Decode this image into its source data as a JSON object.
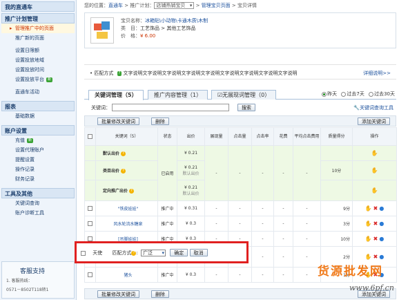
{
  "sidebar": {
    "header": "我的直通车",
    "sections": [
      {
        "title": "推广计划管理",
        "items": [
          {
            "label": "管理推广中的页面",
            "active": true
          },
          {
            "label": "推广新的页面"
          }
        ]
      },
      {
        "title": null,
        "items": [
          {
            "label": "设置日限额"
          },
          {
            "label": "设置投放地域"
          },
          {
            "label": "设置投放时间"
          },
          {
            "label": "设置投放平台",
            "badge": "新"
          }
        ]
      },
      {
        "title": null,
        "items": [
          {
            "label": "直通车活动"
          }
        ]
      },
      {
        "title": "报表",
        "items": [
          {
            "label": "基础数据"
          }
        ]
      },
      {
        "title": "账户设置",
        "items": [
          {
            "label": "充值",
            "badge": "新"
          },
          {
            "label": "设置代理账户"
          },
          {
            "label": "提醒设置"
          },
          {
            "label": "操作记录"
          },
          {
            "label": "财务记录"
          }
        ]
      },
      {
        "title": "工具及其他",
        "items": [
          {
            "label": "关键词查询"
          },
          {
            "label": "账户诊断工具"
          }
        ]
      }
    ],
    "support": {
      "title": "客服支持",
      "line1": "1. 客服热线：",
      "line2": "0571－8502T118转1"
    }
  },
  "breadcrumb": {
    "prefix": "您的位置：",
    "home": "直通车",
    "sep1": ">",
    "plan_label": "推广计划：",
    "plan_value": "店铺热销宝贝",
    "sep2": ">",
    "page": "管理宝贝页面",
    "sep3": ">",
    "current": "宝贝详情"
  },
  "product": {
    "name_label": "宝贝名称：",
    "name": "冰箱贴\\小动物\\卡通木质\\木制",
    "cat_label": "类　目：",
    "cat": "工艺饰品 > 其他工艺饰品",
    "price_label": "价　格：",
    "price": "¥ 6.00"
  },
  "description": {
    "label": "匹配方式",
    "text": "文字说明文字说明文字说明文字说明文字说明文字说明文字说明文字说明文字说明",
    "more": "详细说明>>"
  },
  "tabs": [
    {
      "label": "关键词管理（5）",
      "active": true
    },
    {
      "label": "推广内容管理（1）"
    },
    {
      "label": "无展现词管理（0）"
    }
  ],
  "period": {
    "opt1": "昨天",
    "opt2": "过去7天",
    "opt3": "过去30天"
  },
  "search": {
    "label": "关键词：",
    "button": "搜索",
    "tool": "关键词查询工具"
  },
  "toolbar": {
    "bulk_bid": "批量修改关键词",
    "delete": "删除",
    "add": "添加关键词"
  },
  "columns": [
    "关键词（5）",
    "状态",
    "出价",
    "展现量",
    "点击量",
    "点击率",
    "花费",
    "平均点击费用",
    "质量得分",
    "操作"
  ],
  "rows": [
    {
      "type": "group",
      "keyword": "默认出价",
      "status": "",
      "bid": "¥ 0.21",
      "bid_sub": "",
      "quality": ""
    },
    {
      "type": "group",
      "keyword": "类目出价",
      "status": "已启用",
      "bid": "¥ 0.21",
      "bid_sub": "默认出价",
      "quality": "10分"
    },
    {
      "type": "group",
      "keyword": "定向推广出价",
      "status": "",
      "bid": "¥ 0.21",
      "bid_sub": "默认出价",
      "quality": ""
    },
    {
      "type": "kw",
      "keyword": "\"铁皮娃娃\"",
      "status": "推广中",
      "bid": "¥ 0.31",
      "bid_sub": "",
      "quality": "9分"
    },
    {
      "type": "kw",
      "keyword": "风水轮流水糖泉",
      "status": "推广中",
      "bid": "¥ 0.3",
      "bid_sub": "",
      "quality": "3分"
    },
    {
      "type": "kw",
      "keyword": "[吊脚娃娃]",
      "status": "推广中",
      "bid": "¥ 0.3",
      "bid_sub": "",
      "quality": "10分"
    },
    {
      "type": "kw",
      "keyword": "天使",
      "status": "",
      "bid": "",
      "bid_sub": "",
      "quality": "2分"
    },
    {
      "type": "kw",
      "keyword": "猪头",
      "status": "推广中",
      "bid": "¥ 0.3",
      "bid_sub": "",
      "quality": "1分"
    }
  ],
  "dash": "-",
  "edit_row": {
    "keyword": "天使",
    "match_label": "匹配方式",
    "match_value": "广泛",
    "confirm": "确定",
    "cancel": "取消"
  },
  "watermark": {
    "cn": "货源批发网",
    "url": "www.6pf.cn"
  }
}
